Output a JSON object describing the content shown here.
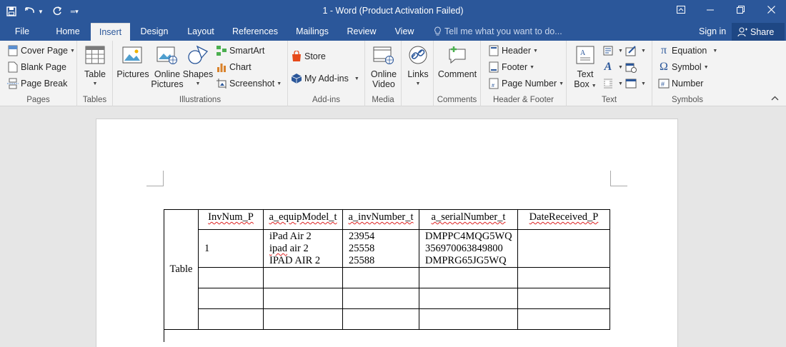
{
  "window": {
    "title": "1 - Word (Product Activation Failed)"
  },
  "tabs": {
    "file": "File",
    "home": "Home",
    "insert": "Insert",
    "design": "Design",
    "layout": "Layout",
    "references": "References",
    "mailings": "Mailings",
    "review": "Review",
    "view": "View"
  },
  "tell_me": "Tell me what you want to do...",
  "sign_in": "Sign in",
  "share": "Share",
  "ribbon": {
    "pages": {
      "label": "Pages",
      "cover_page": "Cover Page",
      "blank_page": "Blank Page",
      "page_break": "Page Break"
    },
    "tables": {
      "label": "Tables",
      "table": "Table"
    },
    "illustrations": {
      "label": "Illustrations",
      "pictures": "Pictures",
      "online_pictures_1": "Online",
      "online_pictures_2": "Pictures",
      "shapes": "Shapes",
      "smartart": "SmartArt",
      "chart": "Chart",
      "screenshot": "Screenshot"
    },
    "addins": {
      "label": "Add-ins",
      "store": "Store",
      "my_addins": "My Add-ins"
    },
    "media": {
      "label": "Media",
      "online_video_1": "Online",
      "online_video_2": "Video"
    },
    "links": {
      "links": "Links"
    },
    "comments": {
      "label": "Comments",
      "comment": "Comment"
    },
    "header_footer": {
      "label": "Header & Footer",
      "header": "Header",
      "footer": "Footer",
      "page_number": "Page Number"
    },
    "text": {
      "label": "Text",
      "text_box_1": "Text",
      "text_box_2": "Box"
    },
    "symbols": {
      "label": "Symbols",
      "equation": "Equation",
      "symbol": "Symbol",
      "number": "Number"
    }
  },
  "document": {
    "side_label": "Table",
    "headers": [
      "InvNum_P",
      "a_equipModel_t",
      "a_invNumber_t",
      "a_serialNumber_t",
      "DateReceived_P"
    ],
    "row1": {
      "invnum": "1",
      "models": [
        "iPad Air 2",
        "ipad air 2",
        "IPAD AIR 2"
      ],
      "inv_numbers": [
        "23954",
        "25558",
        "25588"
      ],
      "serials": [
        "DMPPC4MQG5WQ",
        "356970063849800",
        "DMPRG65JG5WQ"
      ],
      "date": ""
    }
  }
}
